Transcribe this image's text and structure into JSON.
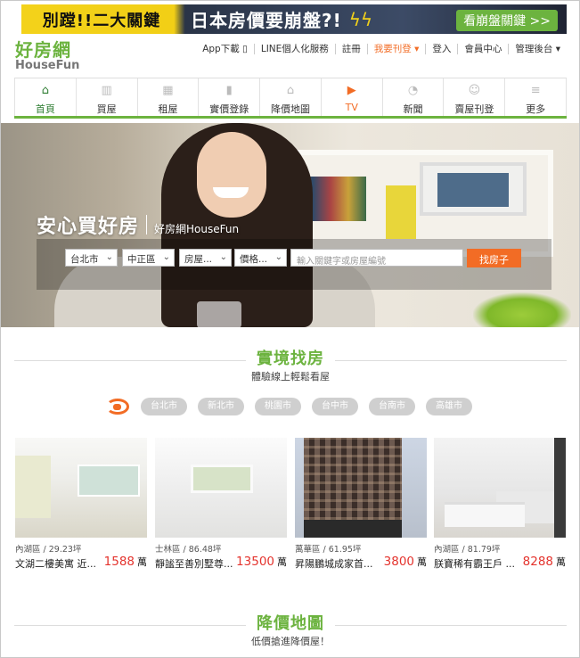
{
  "ad": {
    "text1": "別蹚!!二大關鍵",
    "text2": "日本房價要崩盤?!",
    "cta": "看崩盤關鍵 >>"
  },
  "logo": {
    "line1": "好房網",
    "line2": "HouseFun"
  },
  "toplinks": {
    "app": "App下載 ▯",
    "line": "LINE個人化服務",
    "register": "註冊",
    "post": "我要刊登 ▾",
    "login": "登入",
    "member": "會員中心",
    "admin": "管理後台 ▾"
  },
  "nav": [
    {
      "label": "首頁",
      "icon": "home-icon"
    },
    {
      "label": "買屋",
      "icon": "building-icon"
    },
    {
      "label": "租屋",
      "icon": "apartment-icon"
    },
    {
      "label": "實價登錄",
      "icon": "bar-chart-icon"
    },
    {
      "label": "降價地圖",
      "icon": "house-icon"
    },
    {
      "label": "TV",
      "icon": "play-icon"
    },
    {
      "label": "新聞",
      "icon": "rss-icon"
    },
    {
      "label": "賣屋刊登",
      "icon": "smile-icon"
    },
    {
      "label": "更多",
      "icon": "menu-icon"
    }
  ],
  "hero": {
    "tagline": "安心買好房",
    "brand": "好房網HouseFun",
    "search": {
      "city": "台北市",
      "district": "中正區",
      "type": "房屋...",
      "price": "價格...",
      "keyword_placeholder": "輸入關鍵字或房屋編號",
      "submit": "找房子"
    }
  },
  "section1": {
    "title": "實境找房",
    "subtitle": "體驗線上輕鬆看屋"
  },
  "cities": [
    "台北市",
    "新北市",
    "桃園市",
    "台中市",
    "台南市",
    "高雄市"
  ],
  "listings": [
    {
      "area": "內湖區 / 29.23坪",
      "name": "文湖二樓美寓 近...",
      "price": "1588",
      "unit": "萬"
    },
    {
      "area": "士林區 / 86.48坪",
      "name": "靜謐至善別墅尊...",
      "price": "13500",
      "unit": "萬"
    },
    {
      "area": "萬華區 / 61.95坪",
      "name": "昇陽鵬城成家首...",
      "price": "3800",
      "unit": "萬"
    },
    {
      "area": "內湖區 / 81.79坪",
      "name": "朕寶稀有霸王戶 ...",
      "price": "8288",
      "unit": "萬"
    }
  ],
  "section2": {
    "title": "降價地圖",
    "subtitle": "低價搶進降價屋！"
  }
}
